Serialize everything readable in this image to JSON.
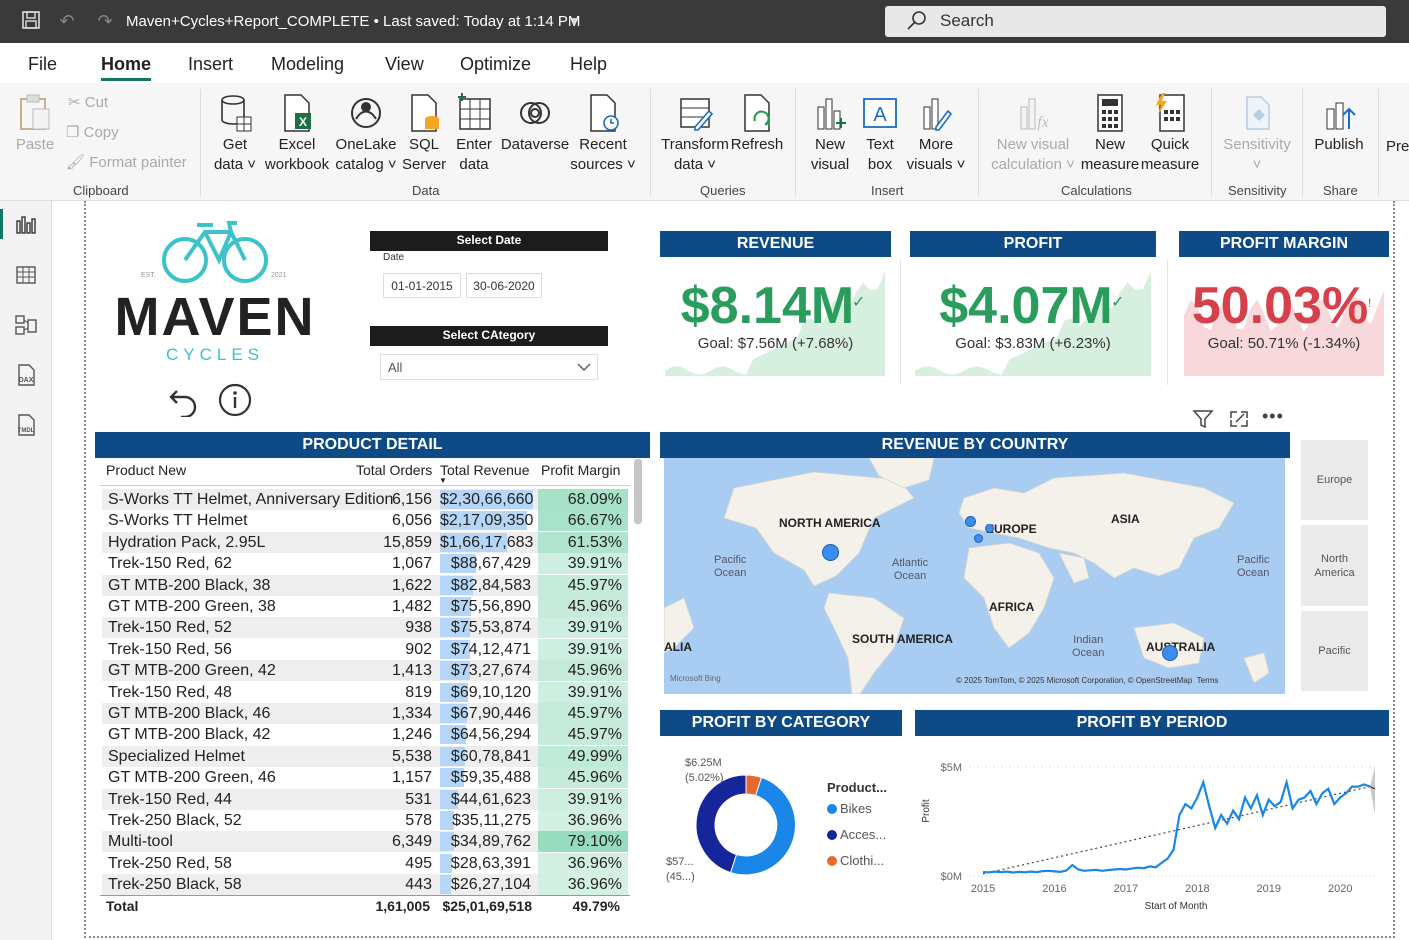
{
  "titlebar": {
    "title": "Maven+Cycles+Report_COMPLETE  •  Last saved: Today at 1:14 PM",
    "search_placeholder": "Search"
  },
  "menu": [
    "File",
    "Home",
    "Insert",
    "Modeling",
    "View",
    "Optimize",
    "Help"
  ],
  "ribbon": {
    "clipboard": {
      "paste": "Paste",
      "cut": "Cut",
      "copy": "Copy",
      "format_painter": "Format painter",
      "group": "Clipboard"
    },
    "data": {
      "get_data": [
        "Get",
        "data ˅"
      ],
      "excel": [
        "Excel",
        "workbook"
      ],
      "onelake": [
        "OneLake",
        "catalog ˅"
      ],
      "sql": [
        "SQL",
        "Server"
      ],
      "enter": [
        "Enter",
        "data"
      ],
      "dataverse": [
        "Dataverse",
        ""
      ],
      "recent": [
        "Recent",
        "sources ˅"
      ],
      "group": "Data"
    },
    "queries": {
      "transform": [
        "Transform",
        "data ˅"
      ],
      "refresh": [
        "Refresh",
        ""
      ],
      "group": "Queries"
    },
    "insert": {
      "new_visual": [
        "New",
        "visual"
      ],
      "text_box": [
        "Text",
        "box"
      ],
      "more_visuals": [
        "More",
        "visuals ˅"
      ],
      "group": "Insert"
    },
    "calculations": {
      "new_visual_calc": [
        "New visual",
        "calculation ˅"
      ],
      "new_measure": [
        "New",
        "measure"
      ],
      "quick_measure": [
        "Quick",
        "measure"
      ],
      "group": "Calculations"
    },
    "sensitivity": {
      "label": [
        "Sensitivity",
        "˅"
      ],
      "group": "Sensitivity"
    },
    "share": {
      "publish": [
        "Publish",
        ""
      ],
      "group": "Share"
    },
    "overflow": "Pre"
  },
  "logo": {
    "brand": "MAVEN",
    "sub": "CYCLES",
    "est": "EST.",
    "year": "2021"
  },
  "date_slicer": {
    "header": "Select Date",
    "label": "Date",
    "from": "01-01-2015",
    "to": "30-06-2020"
  },
  "category_slicer": {
    "header": "Select CAtegory",
    "value": "All"
  },
  "kpis": [
    {
      "title": "REVENUE",
      "value": "$8.14M",
      "goal": "Goal: $7.56M (+7.68%)",
      "status": "good",
      "color": "#2a9d5c"
    },
    {
      "title": "PROFIT",
      "value": "$4.07M",
      "goal": "Goal: $3.83M (+6.23%)",
      "status": "good",
      "color": "#2a9d5c"
    },
    {
      "title": "PROFIT MARGIN",
      "value": "50.03%",
      "goal": "Goal: 50.71% (-1.34%)",
      "status": "bad",
      "color": "#d6404b"
    }
  ],
  "product_detail": {
    "title": "PRODUCT DETAIL",
    "columns": [
      "Product New",
      "Total Orders",
      "Total Revenue",
      "Profit Margin"
    ],
    "rows": [
      {
        "name": "S-Works TT Helmet, Anniversary Edition",
        "orders": "6,156",
        "revenue": "$2,30,66,660",
        "rev_frac": 1.0,
        "margin": "68.09%",
        "m": 68.09
      },
      {
        "name": "S-Works TT Helmet",
        "orders": "6,056",
        "revenue": "$2,17,09,350",
        "rev_frac": 0.94,
        "margin": "66.67%",
        "m": 66.67
      },
      {
        "name": "Hydration Pack, 2.95L",
        "orders": "15,859",
        "revenue": "$1,66,17,683",
        "rev_frac": 0.72,
        "margin": "61.53%",
        "m": 61.53
      },
      {
        "name": "Trek-150 Red, 62",
        "orders": "1,067",
        "revenue": "$88,67,429",
        "rev_frac": 0.384,
        "margin": "39.91%",
        "m": 39.91
      },
      {
        "name": "GT MTB-200 Black, 38",
        "orders": "1,622",
        "revenue": "$82,84,583",
        "rev_frac": 0.359,
        "margin": "45.97%",
        "m": 45.97
      },
      {
        "name": "GT MTB-200 Green, 38",
        "orders": "1,482",
        "revenue": "$75,56,890",
        "rev_frac": 0.328,
        "margin": "45.96%",
        "m": 45.96
      },
      {
        "name": "Trek-150 Red, 52",
        "orders": "938",
        "revenue": "$75,53,874",
        "rev_frac": 0.327,
        "margin": "39.91%",
        "m": 39.91
      },
      {
        "name": "Trek-150 Red, 56",
        "orders": "902",
        "revenue": "$74,12,471",
        "rev_frac": 0.321,
        "margin": "39.91%",
        "m": 39.91
      },
      {
        "name": "GT MTB-200 Green, 42",
        "orders": "1,413",
        "revenue": "$73,27,674",
        "rev_frac": 0.318,
        "margin": "45.96%",
        "m": 45.96
      },
      {
        "name": "Trek-150 Red, 48",
        "orders": "819",
        "revenue": "$69,10,120",
        "rev_frac": 0.3,
        "margin": "39.91%",
        "m": 39.91
      },
      {
        "name": "GT MTB-200 Black, 46",
        "orders": "1,334",
        "revenue": "$67,90,446",
        "rev_frac": 0.294,
        "margin": "45.97%",
        "m": 45.97
      },
      {
        "name": "GT MTB-200 Black, 42",
        "orders": "1,246",
        "revenue": "$64,56,294",
        "rev_frac": 0.28,
        "margin": "45.97%",
        "m": 45.97
      },
      {
        "name": "Specialized Helmet",
        "orders": "5,538",
        "revenue": "$60,78,841",
        "rev_frac": 0.264,
        "margin": "49.99%",
        "m": 49.99
      },
      {
        "name": "GT MTB-200 Green, 46",
        "orders": "1,157",
        "revenue": "$59,35,488",
        "rev_frac": 0.257,
        "margin": "45.96%",
        "m": 45.96
      },
      {
        "name": "Trek-150 Red, 44",
        "orders": "531",
        "revenue": "$44,61,623",
        "rev_frac": 0.193,
        "margin": "39.91%",
        "m": 39.91
      },
      {
        "name": "Trek-250 Black, 52",
        "orders": "578",
        "revenue": "$35,11,275",
        "rev_frac": 0.152,
        "margin": "36.96%",
        "m": 36.96
      },
      {
        "name": "Multi-tool",
        "orders": "6,349",
        "revenue": "$34,89,762",
        "rev_frac": 0.151,
        "margin": "79.10%",
        "m": 79.1
      },
      {
        "name": "Trek-250 Red, 58",
        "orders": "495",
        "revenue": "$28,63,391",
        "rev_frac": 0.124,
        "margin": "36.96%",
        "m": 36.96
      },
      {
        "name": "Trek-250 Black, 58",
        "orders": "443",
        "revenue": "$26,27,104",
        "rev_frac": 0.114,
        "margin": "36.96%",
        "m": 36.96
      }
    ],
    "total": {
      "label": "Total",
      "orders": "1,61,005",
      "revenue": "$25,01,69,518",
      "margin": "49.79%"
    }
  },
  "revenue_by_country": {
    "title": "REVENUE BY COUNTRY",
    "continents": [
      "NORTH AMERICA",
      "EUROPE",
      "ASIA",
      "AFRICA",
      "SOUTH AMERICA",
      "AUSTRALIA",
      "ALIA"
    ],
    "oceans": [
      "Pacific\nOcean",
      "Atlantic\nOcean",
      "Pacific\nOcean",
      "Indian\nOcean"
    ],
    "attribution": "© 2025 TomTom, © 2025 Microsoft Corporation, © OpenStreetMap  Terms",
    "bing": "Microsoft Bing",
    "region_tiles": [
      "Europe",
      "North\nAmerica",
      "Pacific"
    ]
  },
  "profit_by_category": {
    "title": "PROFIT BY CATEGORY",
    "legend_title": "Product...",
    "legend": [
      {
        "name": "Bikes",
        "color": "#1a86e8"
      },
      {
        "name": "Acces...",
        "color": "#14269a"
      },
      {
        "name": "Clothi...",
        "color": "#e8692d"
      }
    ],
    "label_top": "$6.25M\n(5.02%)",
    "label_bottom": "$57...\n(45...)"
  },
  "profit_by_period": {
    "title": "PROFIT BY PERIOD",
    "ylabel": "Profit",
    "xlabel": "Start of Month",
    "y_ticks": [
      "$5M",
      "$0M"
    ],
    "x_ticks": [
      "2015",
      "2016",
      "2017",
      "2018",
      "2019",
      "2020"
    ]
  },
  "chart_data": [
    {
      "type": "pie",
      "title": "PROFIT BY CATEGORY",
      "categories": [
        "Bikes",
        "Accessories",
        "Clothing"
      ],
      "values": [
        49.98,
        45.0,
        5.02
      ],
      "unit": "percent"
    },
    {
      "type": "line",
      "title": "PROFIT BY PERIOD",
      "xlabel": "Start of Month",
      "ylabel": "Profit",
      "ylim": [
        0,
        5
      ],
      "x_range": [
        "2015-01",
        "2020-06"
      ],
      "series": [
        {
          "values_musd": [
            0.18,
            0.17,
            0.2,
            0.18,
            0.2,
            0.16,
            0.19,
            0.17,
            0.2,
            0.18,
            0.22,
            0.24,
            0.21,
            0.19,
            0.25,
            0.5,
            0.3,
            0.24,
            0.26,
            0.28,
            0.24,
            0.27,
            0.3,
            0.32,
            0.3,
            0.34,
            0.38,
            0.36,
            0.44,
            0.4,
            0.6,
            0.8,
            1.2,
            2.8,
            3.3,
            3.1,
            3.6,
            4.3,
            3.2,
            2.2,
            2.8,
            2.4,
            3.0,
            2.6,
            3.6,
            3.1,
            3.7,
            2.8,
            3.5,
            3.2,
            3.4,
            4.3,
            3.1,
            3.5,
            3.6,
            3.9,
            3.3,
            3.8,
            4.0,
            3.3,
            3.6,
            3.8,
            4.1,
            4.1,
            4.2,
            4.1
          ]
        }
      ]
    }
  ]
}
